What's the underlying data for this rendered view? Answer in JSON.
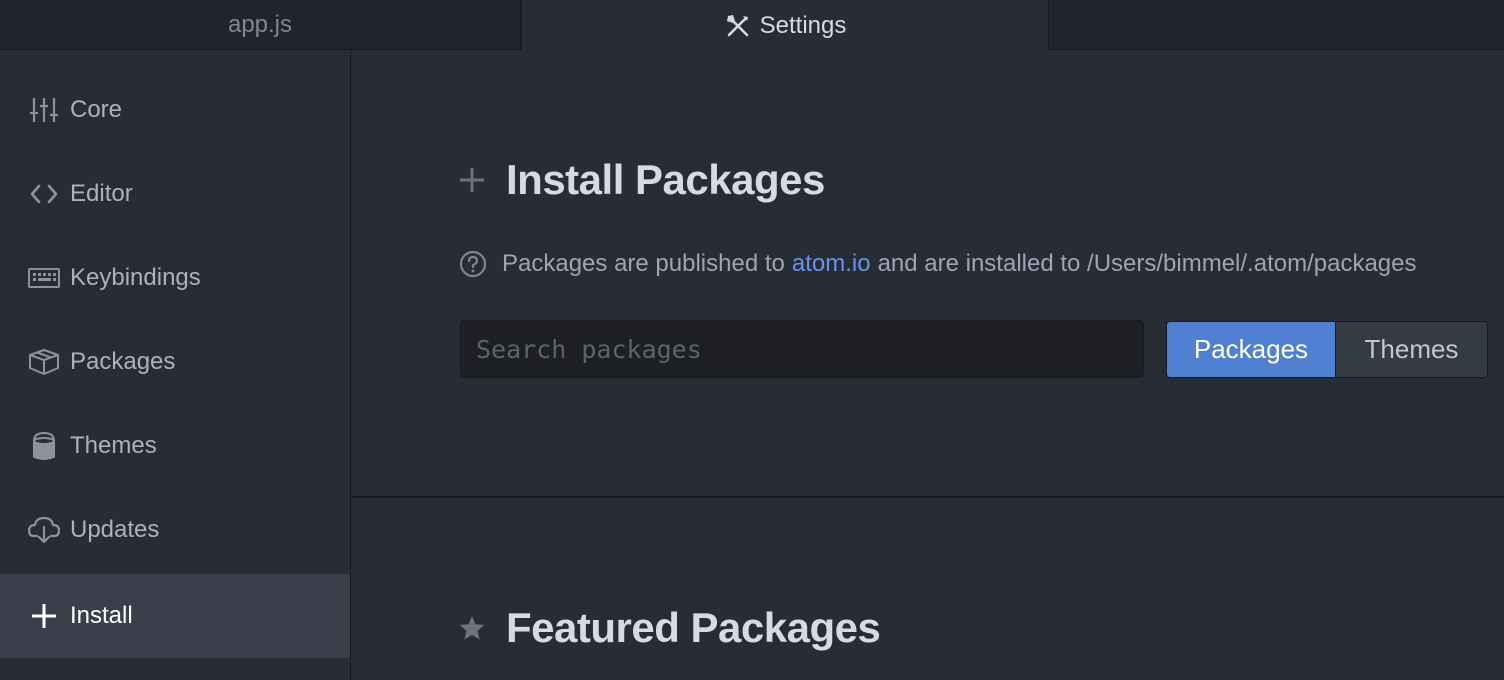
{
  "tabs": [
    {
      "label": "app.js",
      "icon": "file"
    },
    {
      "label": "Settings",
      "icon": "tools-icon"
    }
  ],
  "sidebar": {
    "items": [
      {
        "label": "Core",
        "icon": "sliders-icon"
      },
      {
        "label": "Editor",
        "icon": "code-icon"
      },
      {
        "label": "Keybindings",
        "icon": "keyboard-icon"
      },
      {
        "label": "Packages",
        "icon": "package-icon"
      },
      {
        "label": "Themes",
        "icon": "paintcan-icon"
      },
      {
        "label": "Updates",
        "icon": "cloud-download-icon"
      },
      {
        "label": "Install",
        "icon": "plus-icon"
      }
    ],
    "selected": "Install"
  },
  "install": {
    "title": "Install Packages",
    "info_prefix": "Packages are published to",
    "info_link": "atom.io",
    "info_suffix": "and are installed to /Users/bimmel/.atom/packages",
    "search_placeholder": "Search packages",
    "search_value": "",
    "toggle": {
      "packages_label": "Packages",
      "themes_label": "Themes",
      "selected": "Packages"
    }
  },
  "featured": {
    "title": "Featured Packages"
  },
  "colors": {
    "background": "#282c34",
    "tabbar": "#21252b",
    "selected_item": "#3a3f4b",
    "accent": "#5080d2",
    "link": "#6494ed"
  }
}
